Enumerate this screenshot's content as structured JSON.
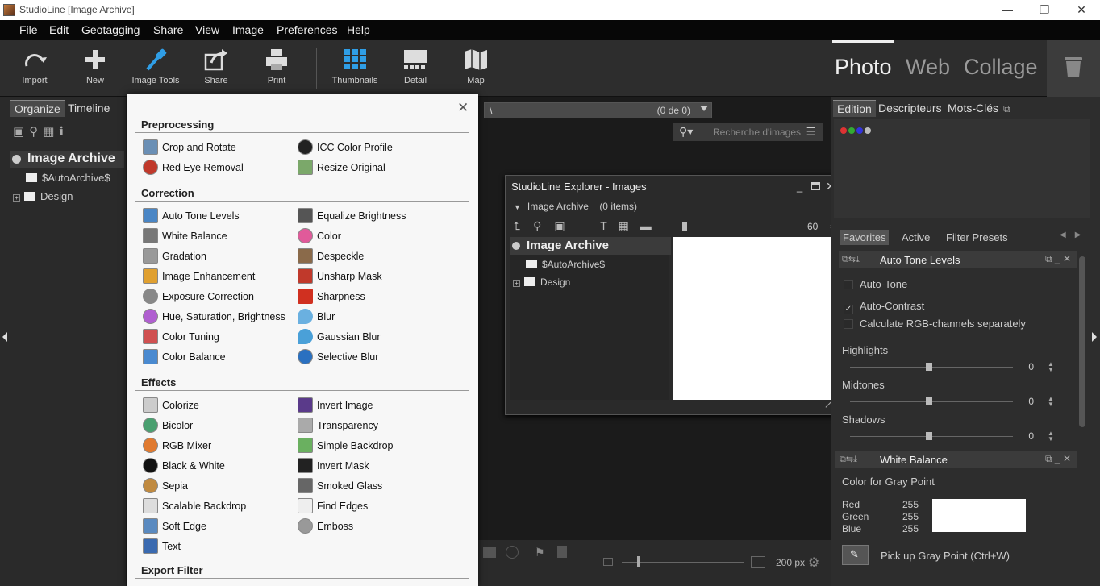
{
  "window": {
    "title": "StudioLine [Image Archive]",
    "controls": [
      "—",
      "❐",
      "✕"
    ]
  },
  "menu": [
    "File",
    "Edit",
    "Geotagging",
    "Share",
    "View",
    "Image",
    "Preferences",
    "Help"
  ],
  "toolbar": {
    "tools": [
      {
        "label": "Import",
        "icon": "import-icon"
      },
      {
        "label": "New",
        "icon": "plus-icon"
      },
      {
        "label": "Image Tools",
        "icon": "pipette-icon"
      },
      {
        "label": "Share",
        "icon": "share-icon"
      },
      {
        "label": "Print",
        "icon": "printer-icon"
      },
      {
        "label": "Thumbnails",
        "icon": "grid-icon"
      },
      {
        "label": "Detail",
        "icon": "detail-icon"
      },
      {
        "label": "Map",
        "icon": "map-icon"
      }
    ],
    "modes": [
      "Photo",
      "Web",
      "Collage"
    ],
    "accent": "#2f9ee6"
  },
  "left_panel": {
    "tabs": [
      "Organize",
      "Timeline"
    ],
    "tree": {
      "root": "Image Archive",
      "children": [
        "$AutoArchive$",
        "Design"
      ]
    }
  },
  "center": {
    "path": "\\",
    "path_count": "(0 de 0)",
    "search_placeholder": "Recherche d'images",
    "zoom_label": "200 px"
  },
  "explorer": {
    "title": "StudioLine Explorer - Images",
    "crumb": "Image Archive",
    "crumb_count": "(0 items)",
    "slider_value": "60",
    "tree": {
      "root": "Image Archive",
      "children": [
        "$AutoArchive$",
        "Design"
      ]
    }
  },
  "popup": {
    "sections": [
      {
        "title": "Preprocessing",
        "items": [
          {
            "label": "Crop and Rotate",
            "color": "#6a8fb5"
          },
          {
            "label": "ICC Color Profile",
            "color": "#222222"
          },
          {
            "label": "Red Eye Removal",
            "color": "#c0392b"
          },
          {
            "label": "Resize Original",
            "color": "#7ba86a"
          }
        ]
      },
      {
        "title": "Correction",
        "items": [
          {
            "label": "Auto Tone Levels",
            "color": "#4a86c5"
          },
          {
            "label": "Equalize Brightness",
            "color": "#555555"
          },
          {
            "label": "White Balance",
            "color": "#777777"
          },
          {
            "label": "Color",
            "color": "#e05a9a"
          },
          {
            "label": "Gradation",
            "color": "#999999"
          },
          {
            "label": "Despeckle",
            "color": "#8a6a4a"
          },
          {
            "label": "Image Enhancement",
            "color": "#e0a030"
          },
          {
            "label": "Unsharp Mask",
            "color": "#c0392b"
          },
          {
            "label": "Exposure Correction",
            "color": "#888888"
          },
          {
            "label": "Sharpness",
            "color": "#d03020"
          },
          {
            "label": "Hue, Saturation, Brightness",
            "color": "#b05fd0"
          },
          {
            "label": "Blur",
            "color": "#6ab0e0"
          },
          {
            "label": "Color Tuning",
            "color": "#d05050"
          },
          {
            "label": "Gaussian Blur",
            "color": "#4aa0d8"
          },
          {
            "label": "Color Balance",
            "color": "#4a8ad0"
          },
          {
            "label": "Selective Blur",
            "color": "#2a70c0"
          }
        ]
      },
      {
        "title": "Effects",
        "items": [
          {
            "label": "Colorize",
            "color": "#cccccc"
          },
          {
            "label": "Invert Image",
            "color": "#5a3a8a"
          },
          {
            "label": "Bicolor",
            "color": "#4aa070"
          },
          {
            "label": "Transparency",
            "color": "#aaaaaa"
          },
          {
            "label": "RGB Mixer",
            "color": "#e07a30"
          },
          {
            "label": "Simple Backdrop",
            "color": "#6ab060"
          },
          {
            "label": "Black & White",
            "color": "#111111"
          },
          {
            "label": "Invert Mask",
            "color": "#222222"
          },
          {
            "label": "Sepia",
            "color": "#c08a40"
          },
          {
            "label": "Smoked Glass",
            "color": "#666666"
          },
          {
            "label": "Scalable Backdrop",
            "color": "#dddddd"
          },
          {
            "label": "Find Edges",
            "color": "#eeeeee"
          },
          {
            "label": "Soft Edge",
            "color": "#5a8ac0"
          },
          {
            "label": "Emboss",
            "color": "#999999"
          },
          {
            "label": "Text",
            "color": "#3a6ab0"
          }
        ]
      },
      {
        "title": "Export Filter",
        "items": []
      }
    ]
  },
  "right_panel": {
    "tabs": [
      "Edition",
      "Descripteurs",
      "Mots-Clés"
    ],
    "subtabs": [
      "Favorites",
      "Active",
      "Filter Presets"
    ],
    "auto_tone": {
      "title": "Auto Tone Levels",
      "options": [
        {
          "label": "Auto-Tone",
          "checked": false
        },
        {
          "label": "Auto-Contrast",
          "checked": true
        },
        {
          "label": "Calculate RGB-channels separately",
          "checked": false
        }
      ],
      "sliders": [
        {
          "label": "Highlights",
          "value": "0"
        },
        {
          "label": "Midtones",
          "value": "0"
        },
        {
          "label": "Shadows",
          "value": "0"
        }
      ]
    },
    "white_balance": {
      "title": "White Balance",
      "subtitle": "Color for Gray Point",
      "channels": [
        {
          "label": "Red",
          "value": "255"
        },
        {
          "label": "Green",
          "value": "255"
        },
        {
          "label": "Blue",
          "value": "255"
        }
      ],
      "pickup_label": "Pick up Gray Point (Ctrl+W)"
    }
  }
}
